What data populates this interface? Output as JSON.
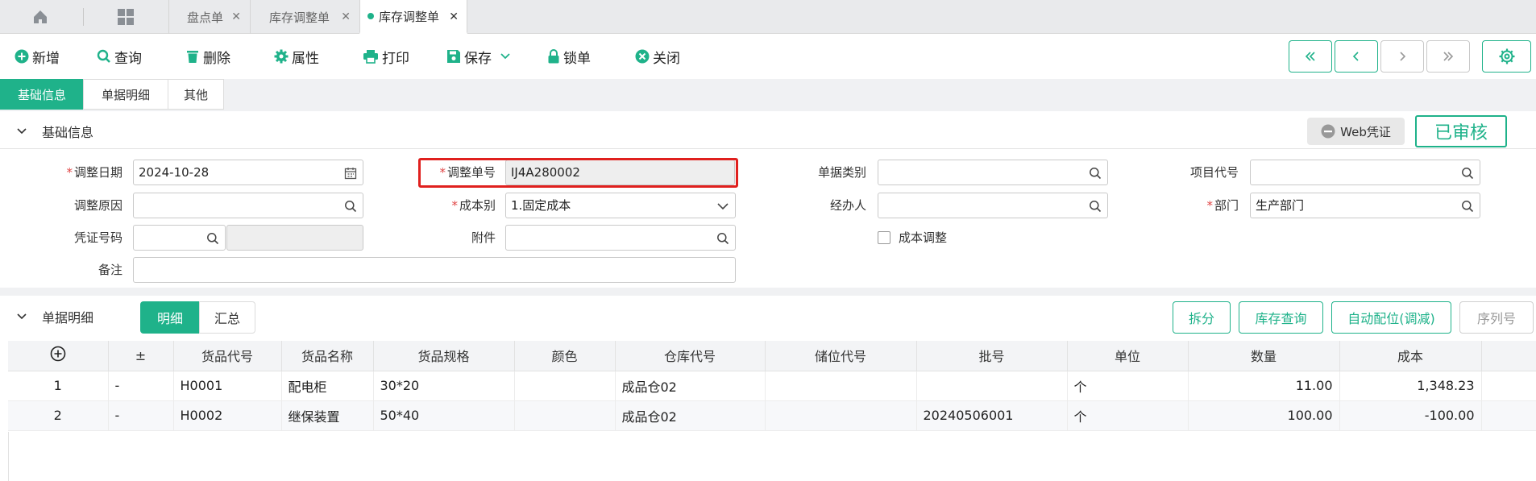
{
  "tabs": [
    {
      "label": "盘点单"
    },
    {
      "label": "库存调整单"
    },
    {
      "label": "库存调整单"
    }
  ],
  "toolbar": {
    "new": "新增",
    "query": "查询",
    "delete": "删除",
    "props": "属性",
    "print": "打印",
    "save": "保存",
    "lock": "锁单",
    "close": "关闭"
  },
  "section_tabs": [
    "基础信息",
    "单据明细",
    "其他"
  ],
  "basic": {
    "title": "基础信息",
    "web_voucher": "Web凭证",
    "stamp": "已审核",
    "labels": {
      "date": "调整日期",
      "no": "调整单号",
      "doc_type": "单据类别",
      "project": "项目代号",
      "reason": "调整原因",
      "cost_type": "成本别",
      "handler": "经办人",
      "dept": "部门",
      "voucher": "凭证号码",
      "attach": "附件",
      "cost_adjust": "成本调整",
      "remark": "备注"
    },
    "values": {
      "date": "2024-10-28",
      "no": "IJ4A280002",
      "cost_type": "1.固定成本",
      "dept": "生产部门"
    }
  },
  "detail": {
    "title": "单据明细",
    "tabs": [
      "明细",
      "汇总"
    ],
    "buttons": [
      "拆分",
      "库存查询",
      "自动配位(调减)",
      "序列号"
    ],
    "headers": [
      "±",
      "货品代号",
      "货品名称",
      "货品规格",
      "颜色",
      "仓库代号",
      "储位代号",
      "批号",
      "单位",
      "数量",
      "成本"
    ],
    "rows": [
      [
        "1",
        "-",
        "H0001",
        "配电柜",
        "30*20",
        "",
        "成品仓02",
        "",
        "",
        "个",
        "11.00",
        "1,348.23"
      ],
      [
        "2",
        "-",
        "H0002",
        "继保装置",
        "50*40",
        "",
        "成品仓02",
        "",
        "20240506001",
        "个",
        "100.00",
        "-100.00"
      ]
    ]
  },
  "colors": {
    "accent": "#1fb28a",
    "required": "#e04545",
    "highlight": "#e0201e"
  }
}
